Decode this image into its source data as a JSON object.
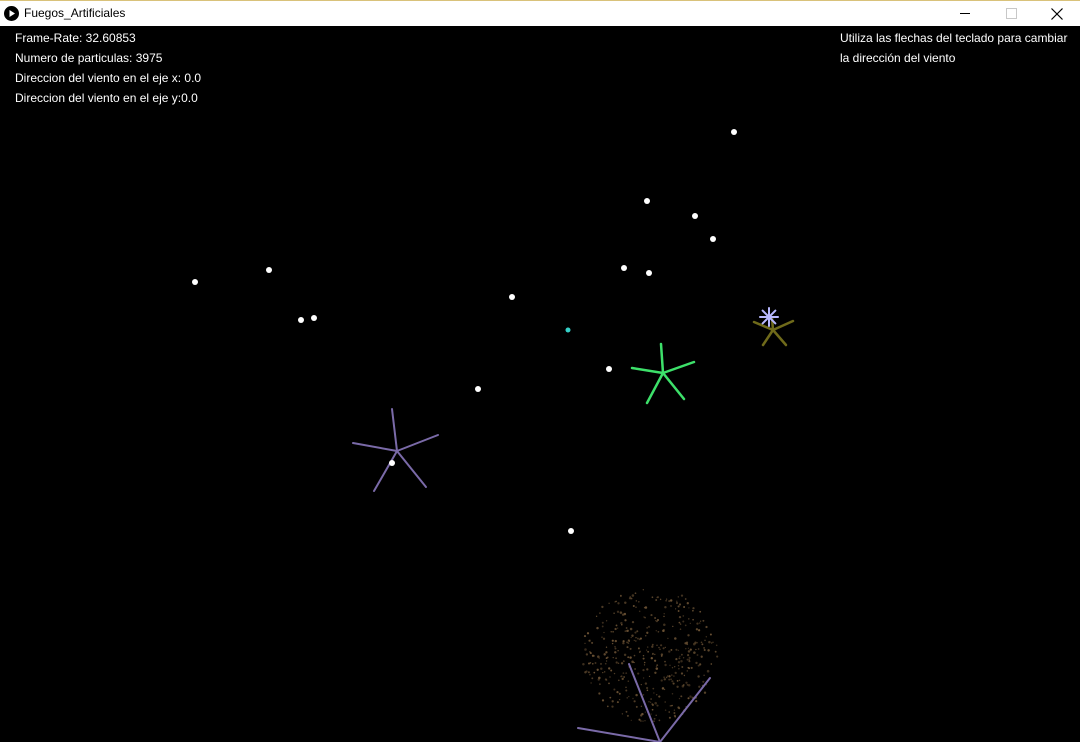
{
  "window": {
    "title": "Fuegos_Artificiales",
    "icon": "play-icon",
    "controls": [
      "minimize-icon",
      "maximize-icon",
      "close-icon"
    ]
  },
  "hud": {
    "frame_rate": "Frame-Rate: 32.60853",
    "particles": "Numero de particulas: 3975",
    "wind_x": "Direccion del viento en el eje x: 0.0",
    "wind_y": "Direccion del viento en el eje y:0.0",
    "instruction_line1": "Utiliza las flechas del teclado para cambiar",
    "instruction_line2": "la dirección del viento"
  },
  "colors": {
    "background": "#000000",
    "text": "#ffffff",
    "rocket": "#ffffff",
    "burst_green": "#3de06a",
    "burst_purple": "#7a6aa8",
    "burst_olive": "#6f6a1a",
    "burst_lavender": "#b8b8ff",
    "burst_cyan": "#35d0c8",
    "dust_brown": "#6b5234"
  }
}
